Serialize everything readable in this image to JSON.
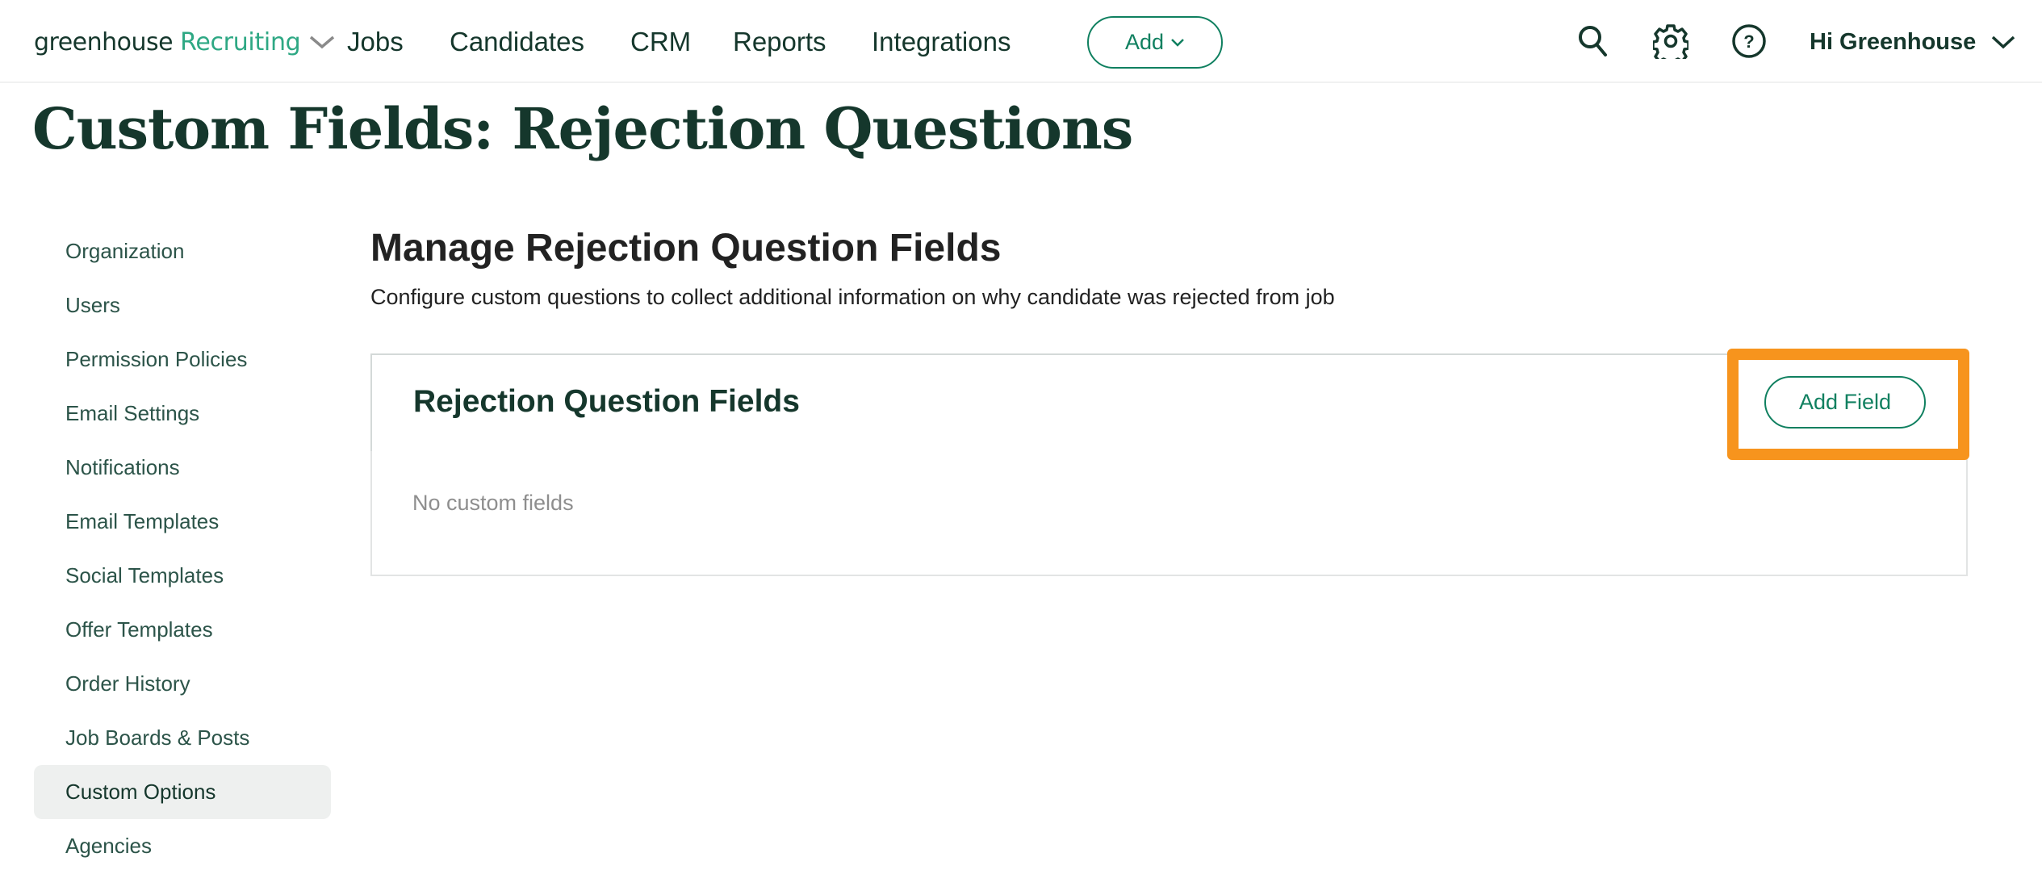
{
  "header": {
    "logo": {
      "brand": "greenhouse",
      "product": "Recruiting"
    },
    "nav": [
      {
        "label": "Jobs"
      },
      {
        "label": "Candidates"
      },
      {
        "label": "CRM"
      },
      {
        "label": "Reports"
      },
      {
        "label": "Integrations"
      }
    ],
    "add_button_label": "Add",
    "icons": [
      "search-icon",
      "gear-icon",
      "help-icon"
    ],
    "user_greeting": "Hi Greenhouse"
  },
  "page": {
    "title": "Custom Fields: Rejection Questions"
  },
  "sidebar": {
    "items": [
      {
        "label": "Organization",
        "active": false
      },
      {
        "label": "Users",
        "active": false
      },
      {
        "label": "Permission Policies",
        "active": false
      },
      {
        "label": "Email Settings",
        "active": false
      },
      {
        "label": "Notifications",
        "active": false
      },
      {
        "label": "Email Templates",
        "active": false
      },
      {
        "label": "Social Templates",
        "active": false
      },
      {
        "label": "Offer Templates",
        "active": false
      },
      {
        "label": "Order History",
        "active": false
      },
      {
        "label": "Job Boards & Posts",
        "active": false
      },
      {
        "label": "Custom Options",
        "active": true
      },
      {
        "label": "Agencies",
        "active": false
      }
    ]
  },
  "main": {
    "section_title": "Manage Rejection Question Fields",
    "section_description": "Configure custom questions to collect additional information on why candidate was rejected from job",
    "panel": {
      "title": "Rejection Question Fields",
      "add_button_label": "Add Field",
      "empty_message": "No custom fields"
    }
  },
  "colors": {
    "brand_dark": "#15372c",
    "brand_accent": "#2ea884",
    "button_green": "#108060",
    "highlight_orange": "#f7941d",
    "active_sidebar_bg": "#eef0ef"
  }
}
